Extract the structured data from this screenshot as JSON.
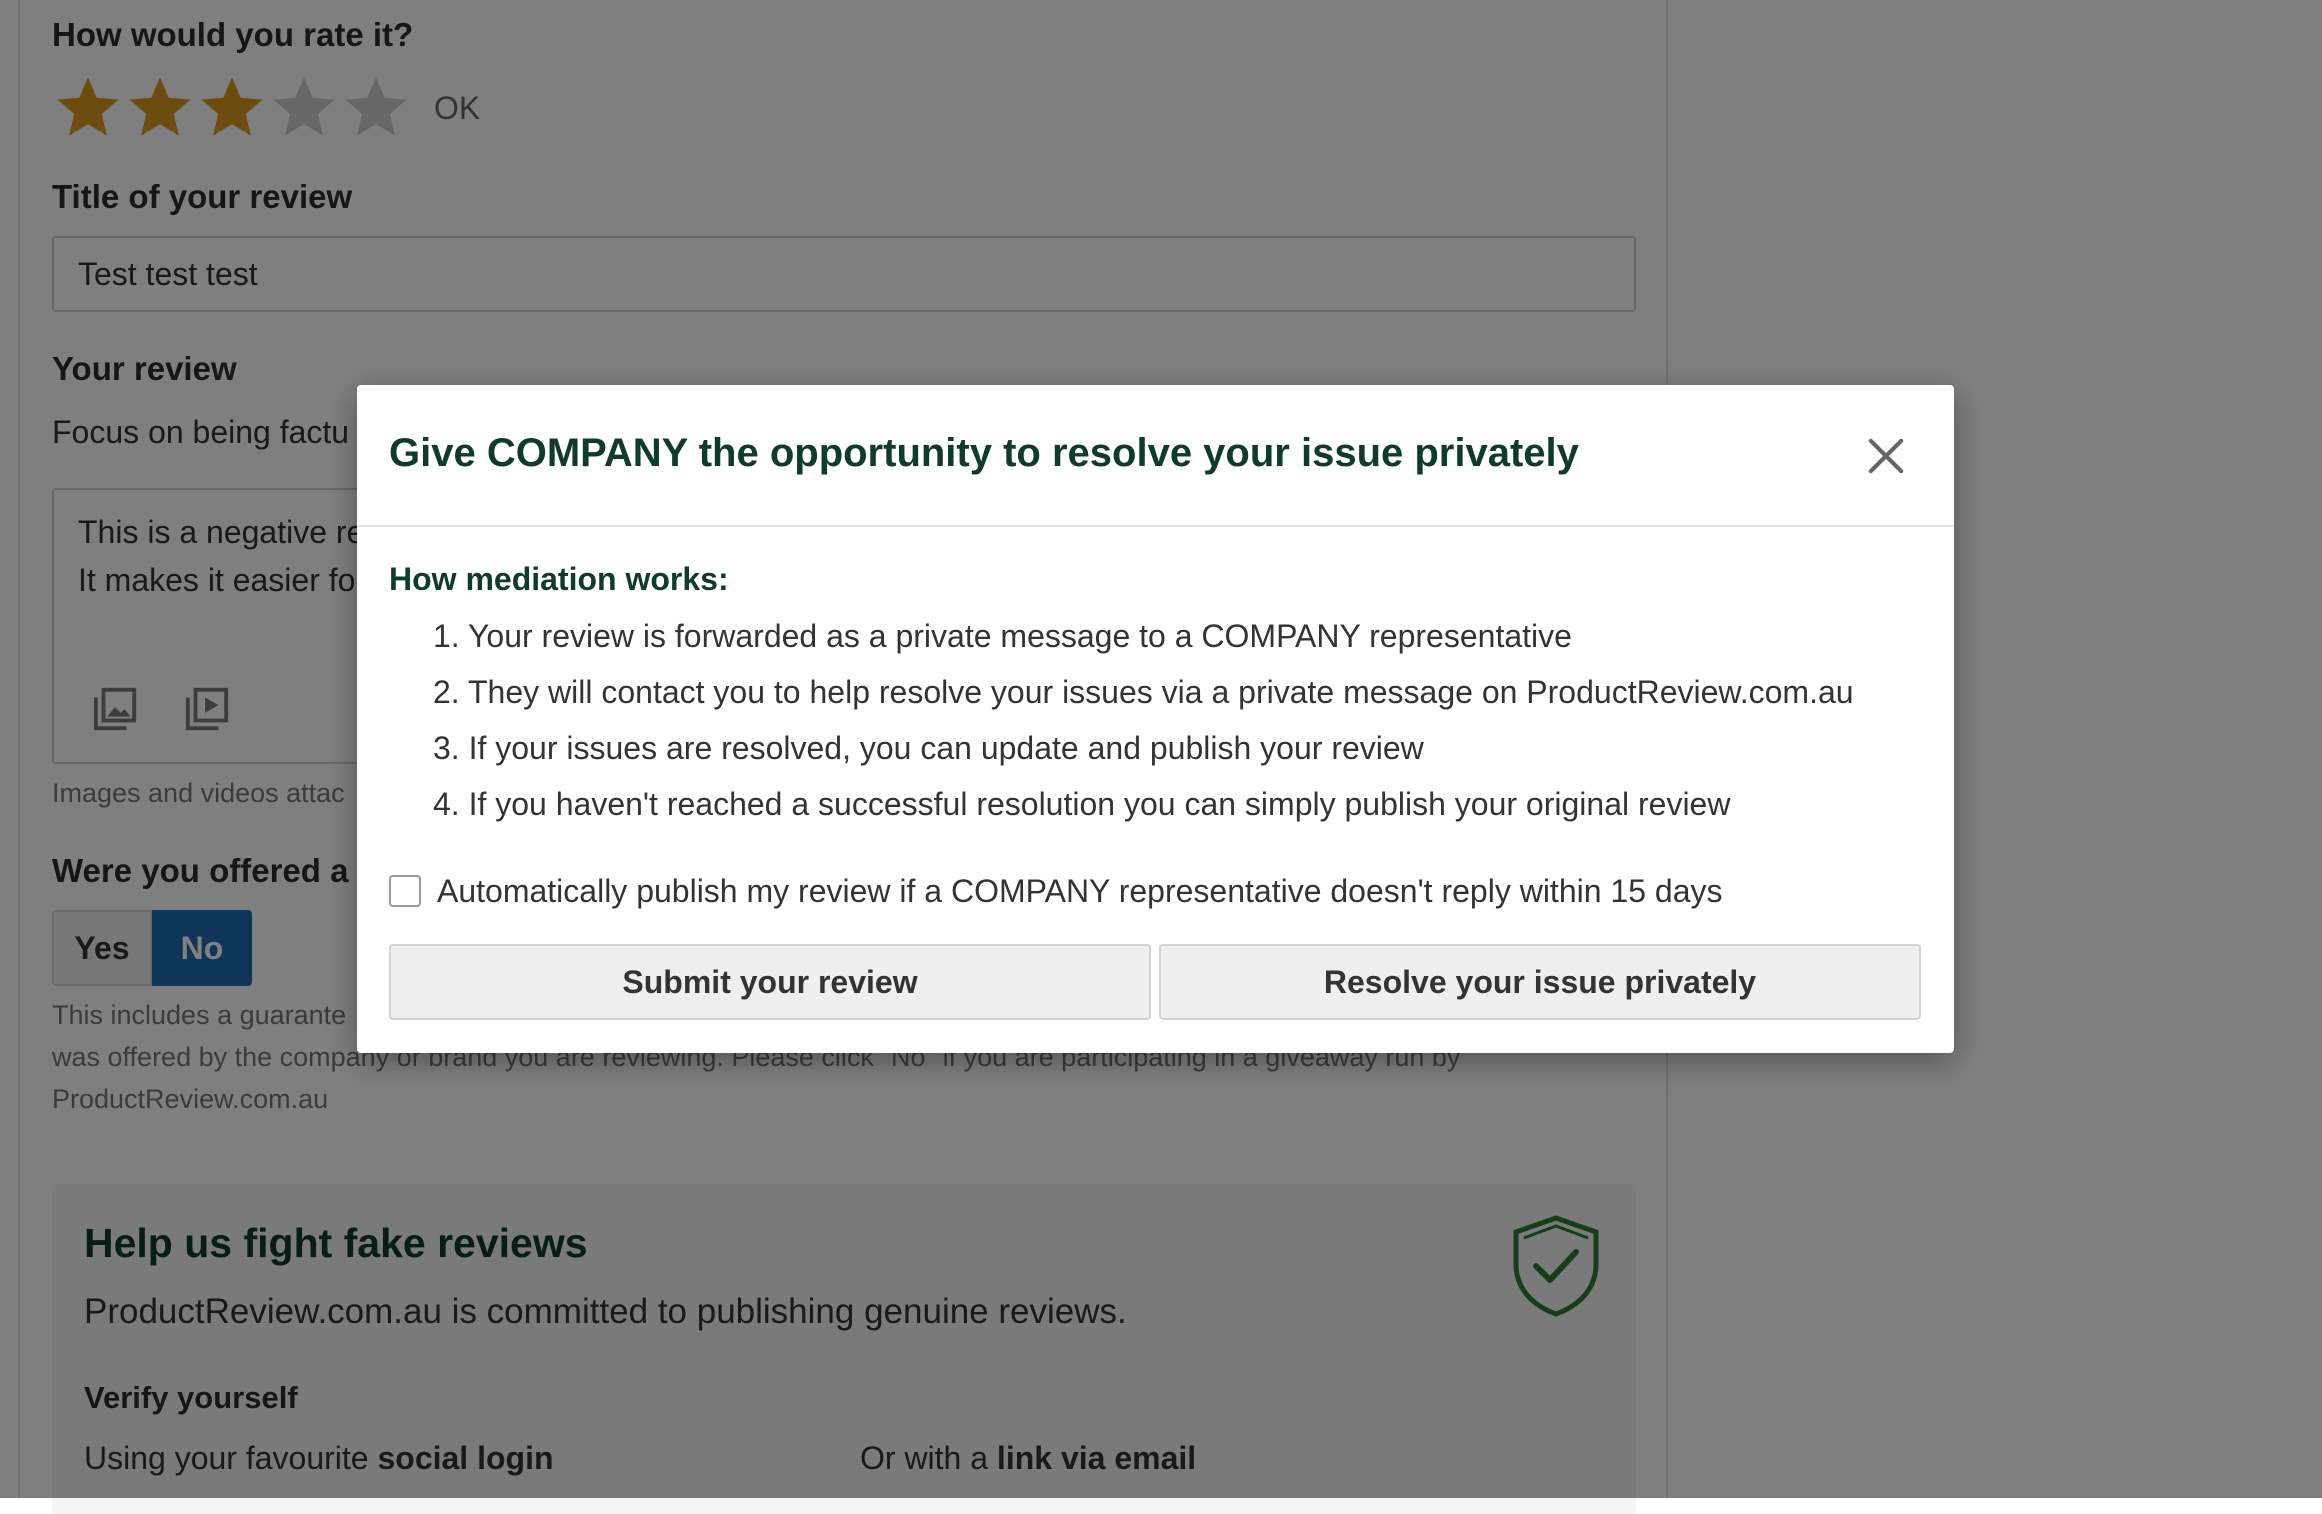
{
  "form": {
    "rating_question": "How would you rate it?",
    "rating": {
      "value": 3,
      "max": 5,
      "label": "OK",
      "filled_color": "#d89b1e",
      "empty_color": "#cfcfcf"
    },
    "title_label": "Title of your review",
    "title_value": "Test test test",
    "review_label": "Your review",
    "review_hint": "Focus on being factu",
    "review_text_line1": "This is a negative re",
    "review_text_line2": "It makes it easier fo",
    "media_icons": [
      "image-upload-icon",
      "video-upload-icon"
    ],
    "media_note": "Images and videos attac",
    "offered_question": "Were you offered a r",
    "yes_label": "Yes",
    "no_label": "No",
    "offered_note_line1": "This includes a guarante",
    "offered_note_line2": "was offered by the company or brand you are reviewing. Please click \"No\" if you are participating in a giveaway run by",
    "offered_note_line3": "ProductReview.com.au"
  },
  "fake_reviews": {
    "title": "Help us fight fake reviews",
    "description": "ProductReview.com.au is committed to publishing genuine reviews.",
    "verify_title": "Verify yourself",
    "social_prefix": "Using your favourite ",
    "social_bold": "social login",
    "email_prefix": "Or with a ",
    "email_bold": "link via email",
    "icon": "shield-check-icon"
  },
  "modal": {
    "title": "Give COMPANY the opportunity to resolve your issue privately",
    "how_title": "How mediation works:",
    "steps": [
      "1. Your review is forwarded as a private message to a COMPANY representative",
      "2. They will contact you to help resolve your issues via a private message on ProductReview.com.au",
      "3. If your issues are resolved, you can update and publish your review",
      "4. If you haven't reached a successful resolution you can simply publish your original review"
    ],
    "auto_publish_label": "Automatically publish my review if a COMPANY representative doesn't reply within 15 days",
    "auto_publish_checked": false,
    "submit_label": "Submit your review",
    "resolve_label": "Resolve your issue privately"
  },
  "colors": {
    "brand_dark_green": "#0f3b2a",
    "selected_blue": "#1e6bb0",
    "overlay": "rgba(0,0,0,0.5)"
  }
}
